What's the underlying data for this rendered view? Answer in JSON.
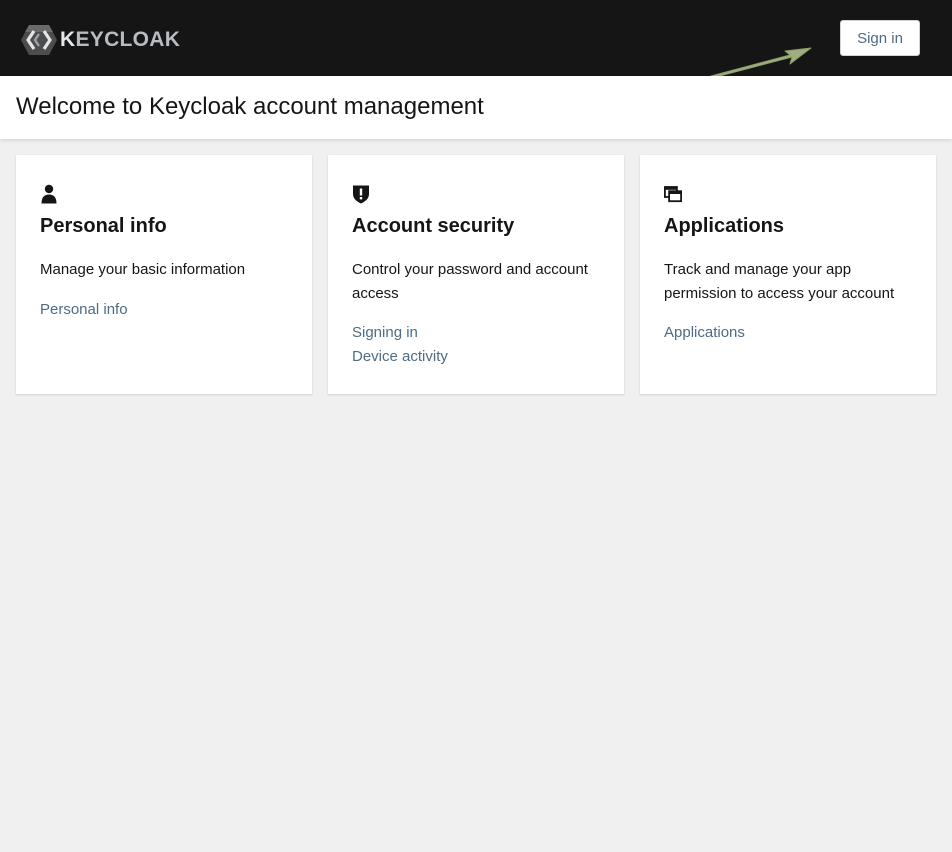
{
  "masthead": {
    "logo_text_first": "K",
    "logo_text_rest": "EYCLOAK",
    "logo_icon": "keycloak-logo-icon",
    "signin_label": "Sign in"
  },
  "header": {
    "title": "Welcome to Keycloak account management"
  },
  "cards": [
    {
      "icon": "user-icon",
      "title": "Personal info",
      "description": "Manage your basic information",
      "links": [
        "Personal info"
      ]
    },
    {
      "icon": "shield-icon",
      "title": "Account security",
      "description": "Control your password and account access",
      "links": [
        "Signing in",
        "Device activity"
      ]
    },
    {
      "icon": "applications-icon",
      "title": "Applications",
      "description": "Track and manage your app permission to access your account",
      "links": [
        "Applications"
      ]
    }
  ],
  "colors": {
    "masthead_bg": "#151515",
    "page_bg": "#f0f0f0",
    "link": "#4f6b86",
    "annotation_arrow": "#9fae7c"
  }
}
